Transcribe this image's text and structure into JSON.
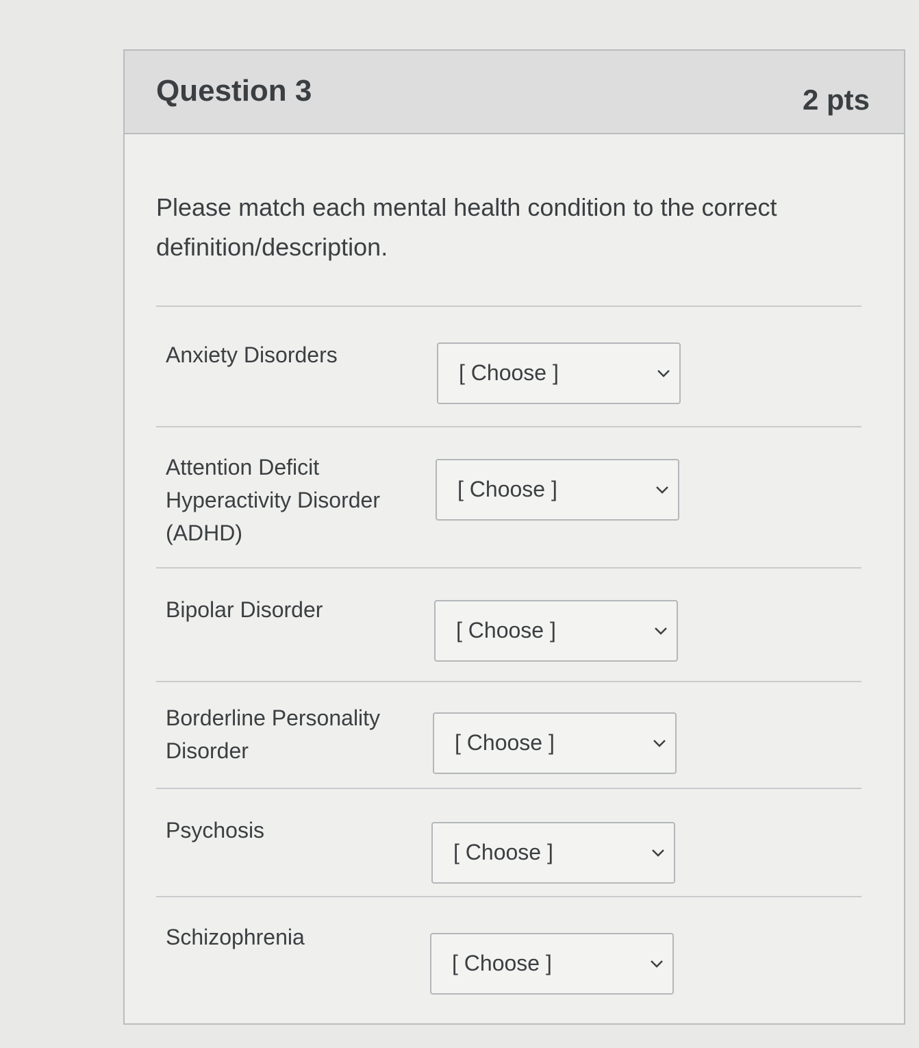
{
  "question": {
    "title": "Question 3",
    "points": "2 pts",
    "prompt": "Please match each mental health condition to the correct definition/description."
  },
  "answers": [
    {
      "label": "Anxiety Disorders",
      "selected": "[ Choose ]"
    },
    {
      "label": "Attention Deficit Hyperactivity Disorder (ADHD)",
      "selected": "[ Choose ]"
    },
    {
      "label": "Bipolar Disorder",
      "selected": "[ Choose ]"
    },
    {
      "label": "Borderline Personality Disorder",
      "selected": "[ Choose ]"
    },
    {
      "label": "Psychosis",
      "selected": "[ Choose ]"
    },
    {
      "label": "Schizophrenia",
      "selected": "[ Choose ]"
    }
  ],
  "icons": {
    "select_indicator": "chevron-down-icon"
  }
}
